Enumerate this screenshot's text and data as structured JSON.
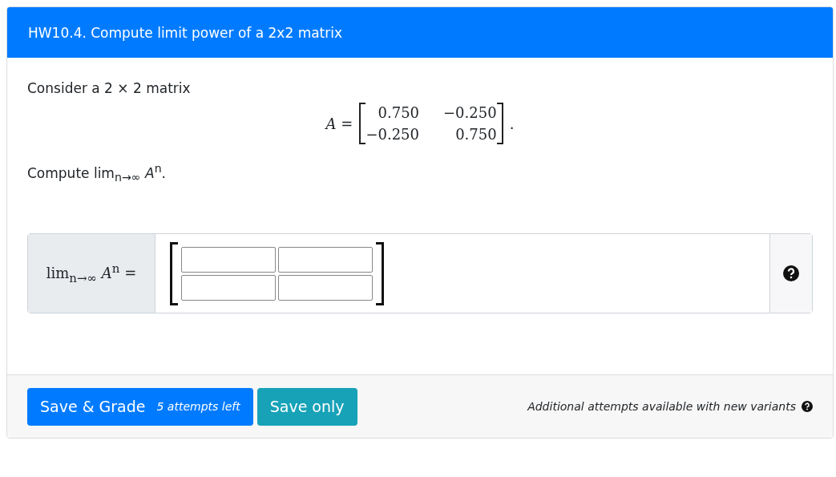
{
  "card": {
    "title": "HW10.4. Compute limit power of a 2x2 matrix"
  },
  "question": {
    "intro": "Consider a 2 × 2 matrix",
    "matrix_label": "*A* =",
    "matrix": [
      [
        "0.750",
        "−0.250"
      ],
      [
        "−0.250",
        "0.750"
      ]
    ],
    "matrix_end": ".",
    "prompt": "Compute lim$_{n→∞}$ *A*$^{n}$."
  },
  "answer": {
    "label": "lim$_{n→∞}$ *A*$^{n}$ =",
    "inputs": [
      [
        {
          "kind": "field"
        },
        {
          "kind": "field"
        }
      ],
      [
        {
          "kind": "field"
        },
        {
          "kind": "field"
        }
      ]
    ]
  },
  "footer": {
    "grade_button": "Save & Grade",
    "attempts": "5 attempts left",
    "save_button": "Save only",
    "note": "Additional attempts available with new variants"
  }
}
